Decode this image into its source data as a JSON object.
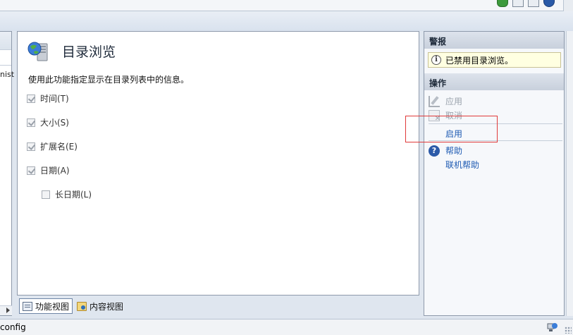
{
  "feature": {
    "title": "目录浏览",
    "description": "使用此功能指定显示在目录列表中的信息。",
    "options": [
      {
        "label": "时间(T)",
        "checked": true,
        "enabled": false
      },
      {
        "label": "大小(S)",
        "checked": true,
        "enabled": false
      },
      {
        "label": "扩展名(E)",
        "checked": true,
        "enabled": false
      },
      {
        "label": "日期(A)",
        "checked": true,
        "enabled": false
      },
      {
        "label": "长日期(L)",
        "checked": false,
        "enabled": false
      }
    ]
  },
  "left_pane": {
    "truncated_label": "nist"
  },
  "view_tabs": {
    "features_view": "功能视图",
    "content_view": "内容视图"
  },
  "actions_pane": {
    "alerts_header": "警报",
    "alert_message": "已禁用目录浏览。",
    "actions_header": "操作",
    "apply": "应用",
    "cancel": "取消",
    "enable": "启用",
    "help": "帮助",
    "online_help": "联机帮助"
  },
  "status_bar": {
    "text": "config"
  },
  "colors": {
    "link": "#1f5bb3",
    "highlight_box": "#e03a3a",
    "alert_background": "#ffffe1"
  },
  "icons": [
    "feature-directory-browsing-icon",
    "info-icon",
    "apply-icon",
    "cancel-icon",
    "help-icon",
    "features-view-icon",
    "content-view-icon",
    "network-status-icon"
  ]
}
